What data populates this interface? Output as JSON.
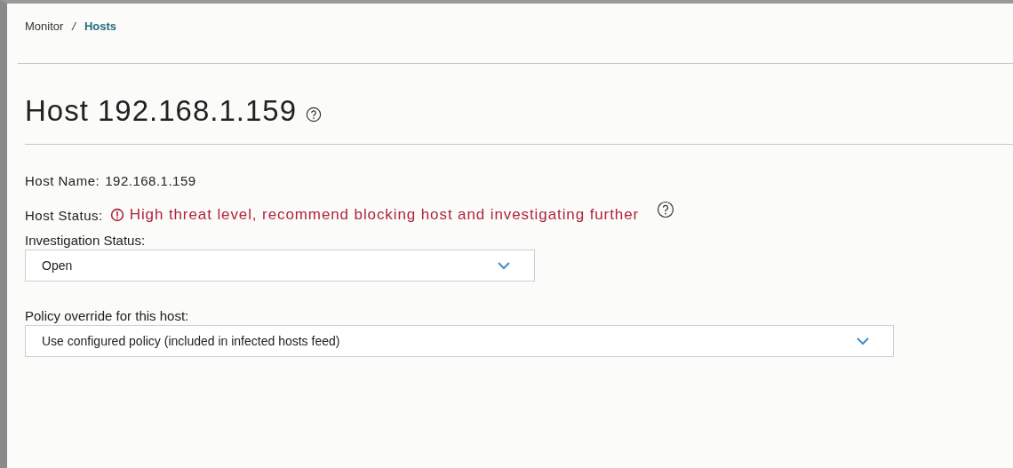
{
  "breadcrumb": [
    {
      "label": "Monitor",
      "current": false
    },
    {
      "label": "Hosts",
      "current": true
    }
  ],
  "breadcrumb_separator": "/",
  "title": "Host 192.168.1.159",
  "host_name": {
    "label": "Host Name:",
    "value": "192.168.1.159"
  },
  "host_status": {
    "label": "Host Status:",
    "alert": true,
    "message": "High threat level, recommend blocking host and investigating further"
  },
  "investigation_status": {
    "label": "Investigation Status:",
    "value": "Open"
  },
  "policy_override": {
    "label": "Policy override for this host:",
    "value": "Use configured policy (included in infected hosts feed)"
  }
}
